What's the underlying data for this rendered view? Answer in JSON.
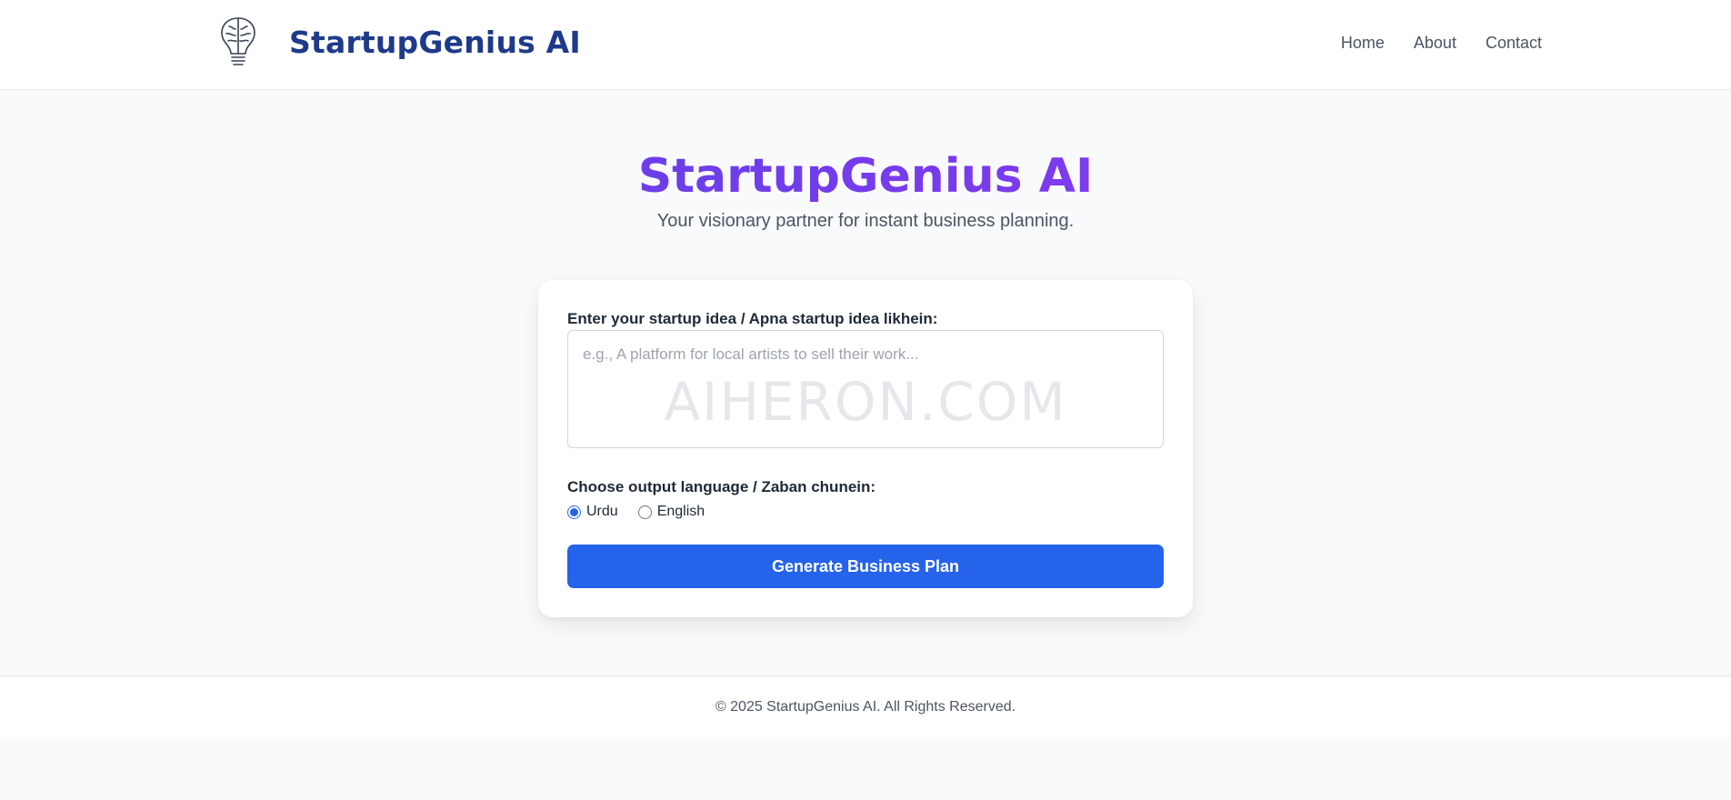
{
  "header": {
    "brand_name": "StartupGenius AI",
    "logo_icon": "brain-bulb-icon",
    "nav": [
      {
        "label": "Home"
      },
      {
        "label": "About"
      },
      {
        "label": "Contact"
      }
    ]
  },
  "hero": {
    "title": "StartupGenius AI",
    "subtitle": "Your visionary partner for instant business planning."
  },
  "form": {
    "idea_label": "Enter your startup idea / Apna startup idea likhein:",
    "idea_placeholder": "e.g., A platform for local artists to sell their work...",
    "idea_value": "",
    "watermark": "AIHERON.COM",
    "language_label": "Choose output language / Zaban chunein:",
    "language_options": [
      {
        "label": "Urdu",
        "selected": true
      },
      {
        "label": "English",
        "selected": false
      }
    ],
    "submit_label": "Generate Business Plan"
  },
  "footer": {
    "text": "© 2025 StartupGenius AI. All Rights Reserved."
  },
  "colors": {
    "brand": "#1e3a8a",
    "accent": "#2563eb",
    "gradient_start": "#4f46e5",
    "gradient_end": "#8b5cf6"
  }
}
